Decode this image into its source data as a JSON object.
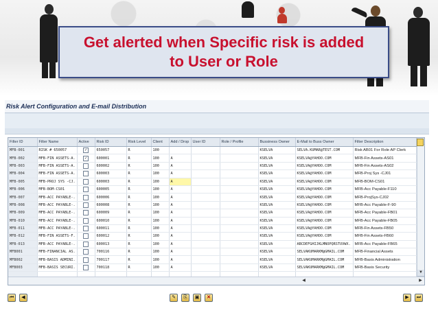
{
  "slide": {
    "title_line1": "Get alerted when Specific risk is added",
    "title_line2": "to User or Role"
  },
  "screen": {
    "title": "Risk Alert Configuration and E-mail Distribution"
  },
  "table": {
    "columns": [
      "Filter ID",
      "Filter Name",
      "Active",
      "Risk ID",
      "Risk Level",
      "Client",
      "Add / Drop",
      "User ID",
      "Role / Profile",
      "Bussiness Owner",
      "E-Mail to Buss Owner",
      "Filter Description"
    ],
    "rows": [
      {
        "filter_id": "MFB-001",
        "filter_name": "RISK # 650057",
        "active": true,
        "risk_id": "650057",
        "risk_level": "R",
        "client": "100",
        "add_drop": "",
        "user_id": "",
        "role": "",
        "owner": "KSELVA",
        "email": "SELVA.KUMAR@TEST.COM",
        "desc": "Risk AB01 For Role AP Clerk"
      },
      {
        "filter_id": "MFB-002",
        "filter_name": "MFB-FIN ASSETS-A.",
        "active": true,
        "risk_id": "600001",
        "risk_level": "R",
        "client": "100",
        "add_drop": "A",
        "user_id": "",
        "role": "",
        "owner": "KSELVA",
        "email": "KSELVA@YAHOO.COM",
        "desc": "MFB-Fin Assets-AS01"
      },
      {
        "filter_id": "MFB-003",
        "filter_name": "MFB-FIN ASSETS-A.",
        "active": false,
        "risk_id": "600002",
        "risk_level": "R",
        "client": "100",
        "add_drop": "A",
        "user_id": "",
        "role": "",
        "owner": "KSELVA",
        "email": "KSELVA@YAHOO.COM",
        "desc": "MFB-Fin Assets-AS02"
      },
      {
        "filter_id": "MFB-004",
        "filter_name": "MFB-FIN ASSETS-A.",
        "active": false,
        "risk_id": "600003",
        "risk_level": "R",
        "client": "100",
        "add_drop": "A",
        "user_id": "",
        "role": "",
        "owner": "KSELVA",
        "email": "KSELVA@YAHOO.COM",
        "desc": "MFB-Proj Sys -CJ01"
      },
      {
        "filter_id": "MFB-005",
        "filter_name": "MFB-PROJ SYS -CJ.",
        "active": false,
        "risk_id": "600003",
        "risk_level": "R",
        "client": "100",
        "add_drop": "A",
        "user_id": "",
        "role": "",
        "owner": "KSELVA",
        "email": "KSELVA@YAHOO.COM",
        "desc": "MFB-BOM-CS01",
        "highlight": true
      },
      {
        "filter_id": "MFB-006",
        "filter_name": "MFB-BOM-CS01",
        "active": false,
        "risk_id": "600005",
        "risk_level": "R",
        "client": "100",
        "add_drop": "A",
        "user_id": "",
        "role": "",
        "owner": "KSELVA",
        "email": "KSELVA@YAHOO.COM",
        "desc": "MFB-Acc Payable-F110"
      },
      {
        "filter_id": "MFB-007",
        "filter_name": "MFB-ACC PAYABLE-.",
        "active": false,
        "risk_id": "600006",
        "risk_level": "R",
        "client": "100",
        "add_drop": "A",
        "user_id": "",
        "role": "",
        "owner": "KSELVA",
        "email": "KSELVA@YAHOO.COM",
        "desc": "MFB-ProjSys-CJ02"
      },
      {
        "filter_id": "MFB-008",
        "filter_name": "MFB-ACC PAYABLE-.",
        "active": false,
        "risk_id": "600008",
        "risk_level": "R",
        "client": "100",
        "add_drop": "A",
        "user_id": "",
        "role": "",
        "owner": "KSELVA",
        "email": "KSELVA@YAHOO.COM",
        "desc": "MFB-Acc Payable-F-90"
      },
      {
        "filter_id": "MFB-009",
        "filter_name": "MFB-ACC PAYABLE-.",
        "active": false,
        "risk_id": "600009",
        "risk_level": "R",
        "client": "100",
        "add_drop": "A",
        "user_id": "",
        "role": "",
        "owner": "KSELVA",
        "email": "KSELVA@YAHOO.COM",
        "desc": "MFB-Acc Payable-FB01"
      },
      {
        "filter_id": "MFB-010",
        "filter_name": "MFB-ACC PAYABLE-.",
        "active": false,
        "risk_id": "600010",
        "risk_level": "R",
        "client": "100",
        "add_drop": "A",
        "user_id": "",
        "role": "",
        "owner": "KSELVA",
        "email": "KSELVA@YAHOO.COM",
        "desc": "MFB-Acc Payable-FB05"
      },
      {
        "filter_id": "MFB-011",
        "filter_name": "MFB-ACC PAYABLE-.",
        "active": false,
        "risk_id": "600011",
        "risk_level": "R",
        "client": "100",
        "add_drop": "A",
        "user_id": "",
        "role": "",
        "owner": "KSELVA",
        "email": "KSELVA@YAHOO.COM",
        "desc": "MFB-Fin Assets-FB50"
      },
      {
        "filter_id": "MFB-012",
        "filter_name": "MFB-FIN ASSETS-F.",
        "active": false,
        "risk_id": "600012",
        "risk_level": "R",
        "client": "100",
        "add_drop": "A",
        "user_id": "",
        "role": "",
        "owner": "KSELVA",
        "email": "KSELVA@YAHOO.COM",
        "desc": "MFB-Fin Assets-FB60"
      },
      {
        "filter_id": "MFB-013",
        "filter_name": "MFB-ACC PAYABLE-.",
        "active": false,
        "risk_id": "600013",
        "risk_level": "R",
        "client": "100",
        "add_drop": "A",
        "user_id": "",
        "role": "",
        "owner": "KSELVA",
        "email": "ABCDEFGHIJKLMNOPQRSTUVWX.",
        "desc": "MFB-Acc Payable-FB65"
      },
      {
        "filter_id": "MFB001",
        "filter_name": "MFB-FINANCIAL AS.",
        "active": false,
        "risk_id": "700116",
        "risk_level": "R",
        "client": "100",
        "add_drop": "A",
        "user_id": "",
        "role": "",
        "owner": "KSELVA",
        "email": "SELVAKUMARKM@GMAIL.COM",
        "desc": "MFB-Financial Assets"
      },
      {
        "filter_id": "MFB002",
        "filter_name": "MFB-BASIS ADMINI.",
        "active": false,
        "risk_id": "700117",
        "risk_level": "R",
        "client": "100",
        "add_drop": "A",
        "user_id": "",
        "role": "",
        "owner": "KSELVA",
        "email": "SELVAKUMARKM@GMAIL.COM",
        "desc": "MFB-Basis Administration"
      },
      {
        "filter_id": "MFB003",
        "filter_name": "MFB-BASIS SECURI.",
        "active": false,
        "risk_id": "700118",
        "risk_level": "R",
        "client": "100",
        "add_drop": "A",
        "user_id": "",
        "role": "",
        "owner": "KSELVA",
        "email": "SELVAKUMARKM@GMAIL.COM",
        "desc": "MFB-Basis Security"
      },
      {
        "filter_id": "",
        "filter_name": "",
        "active": null,
        "risk_id": "",
        "risk_level": "",
        "client": "",
        "add_drop": "",
        "user_id": "",
        "role": "",
        "owner": "",
        "email": "",
        "desc": ""
      }
    ]
  },
  "toolbar": {
    "first_page_icon": "first-page-icon",
    "prev_page_icon": "prev-page-icon",
    "next_page_icon": "next-page-icon",
    "last_page_icon": "last-page-icon"
  }
}
